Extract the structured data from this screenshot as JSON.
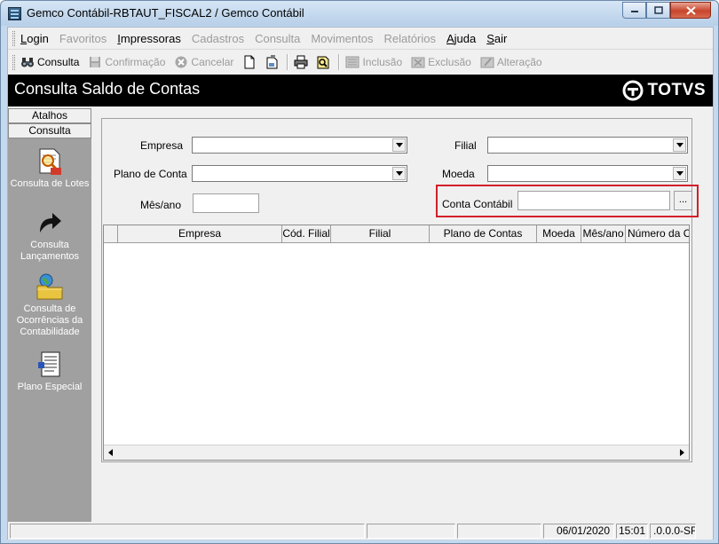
{
  "window": {
    "title": "Gemco Contábil-RBTAUT_FISCAL2 / Gemco Contábil"
  },
  "menu": {
    "items": [
      {
        "label": "Login",
        "enabled": true
      },
      {
        "label": "Favoritos",
        "enabled": false
      },
      {
        "label": "Impressoras",
        "enabled": true
      },
      {
        "label": "Cadastros",
        "enabled": false
      },
      {
        "label": "Consulta",
        "enabled": false
      },
      {
        "label": "Movimentos",
        "enabled": false
      },
      {
        "label": "Relatórios",
        "enabled": false
      },
      {
        "label": "Ajuda",
        "enabled": true
      },
      {
        "label": "Sair",
        "enabled": true
      }
    ]
  },
  "toolbar": {
    "consulta": "Consulta",
    "confirmacao": "Confirmação",
    "cancelar": "Cancelar",
    "inclusao": "Inclusão",
    "exclusao": "Exclusão",
    "alteracao": "Alteração"
  },
  "header": {
    "title": "Consulta Saldo de Contas",
    "logo": "TOTVS"
  },
  "sidebar": {
    "tabs": [
      "Atalhos",
      "Consulta"
    ],
    "shortcuts": [
      {
        "label": "Consulta de Lotes",
        "icon": "document-magnifier-icon"
      },
      {
        "label": "Consulta Lançamentos",
        "icon": "curved-arrow-icon"
      },
      {
        "label": "Consulta de Ocorrências da Contabilidade",
        "icon": "folder-globe-icon"
      },
      {
        "label": "Plano Especial",
        "icon": "notepad-icon"
      }
    ]
  },
  "form": {
    "empresa_label": "Empresa",
    "empresa_value": "",
    "filial_label": "Filial",
    "filial_value": "",
    "plano_label": "Plano de Conta",
    "plano_value": "",
    "moeda_label": "Moeda",
    "moeda_value": "",
    "mesano_label": "Mês/ano",
    "mesano_value": "",
    "conta_label": "Conta Contábil",
    "conta_value": "",
    "lookup_label": "..."
  },
  "grid": {
    "columns": [
      "",
      "Empresa",
      "Cód. Filial",
      "Filial",
      "Plano de Contas",
      "Moeda",
      "Mês/ano",
      "Número da Co"
    ],
    "rows": []
  },
  "status": {
    "date": "06/01/2020",
    "time": "15:01",
    "version": ".0.0.0-SF"
  },
  "colors": {
    "header_bg": "#000000",
    "sidebar_bg": "#a0a0a0",
    "highlight": "#d21f2a"
  }
}
